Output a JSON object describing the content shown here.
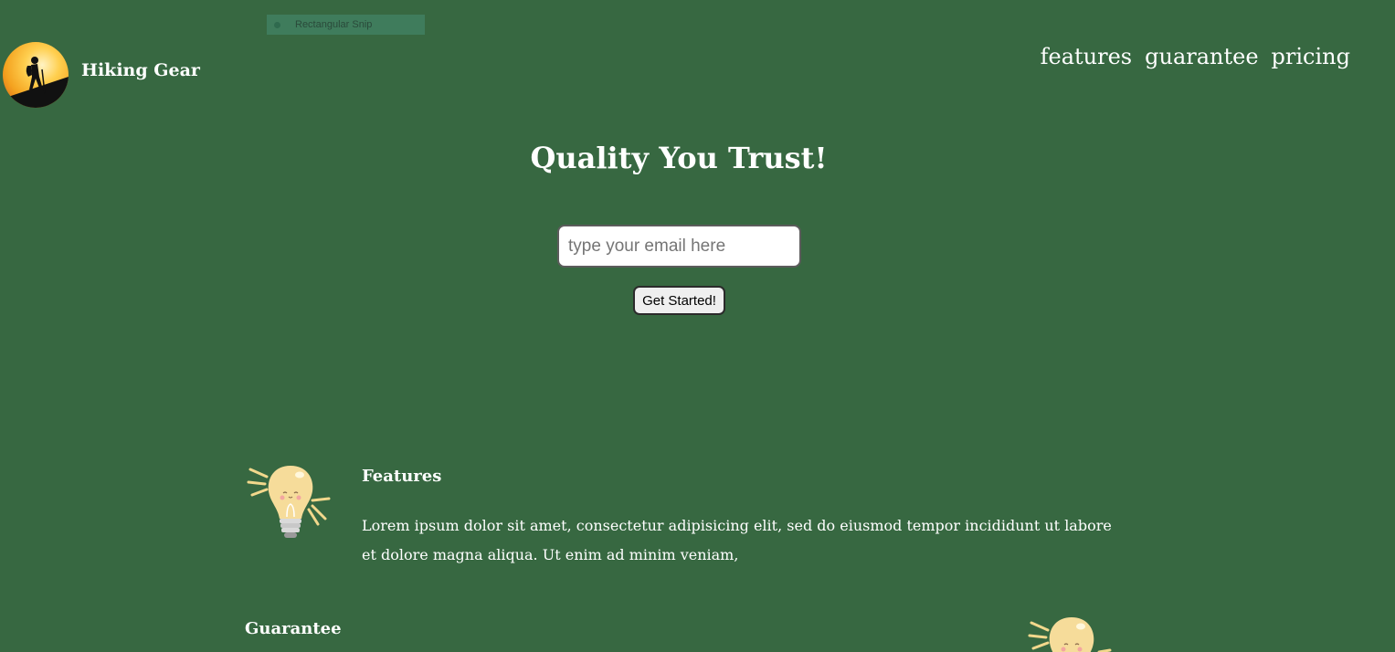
{
  "snip_overlay": {
    "label": "Rectangular Snip"
  },
  "header": {
    "brand": "Hiking Gear",
    "nav": [
      {
        "label": "features"
      },
      {
        "label": "guarantee"
      },
      {
        "label": "pricing"
      }
    ]
  },
  "hero": {
    "title": "Quality You Trust!",
    "email_placeholder": "type your email here",
    "email_value": "",
    "cta_label": "Get Started!"
  },
  "sections": {
    "features": {
      "title": "Features",
      "text": "Lorem ipsum dolor sit amet, consectetur adipisicing elit, sed do eiusmod tempor incididunt ut labore et dolore magna aliqua. Ut enim ad minim veniam,"
    },
    "guarantee": {
      "title": "Guarantee"
    }
  },
  "icons": {
    "logo": "hiker-sunset-logo",
    "section_icon": "lightbulb-icon"
  },
  "colors": {
    "background": "#376841",
    "text": "#ffffff",
    "bulb": "#f6dc9a"
  }
}
